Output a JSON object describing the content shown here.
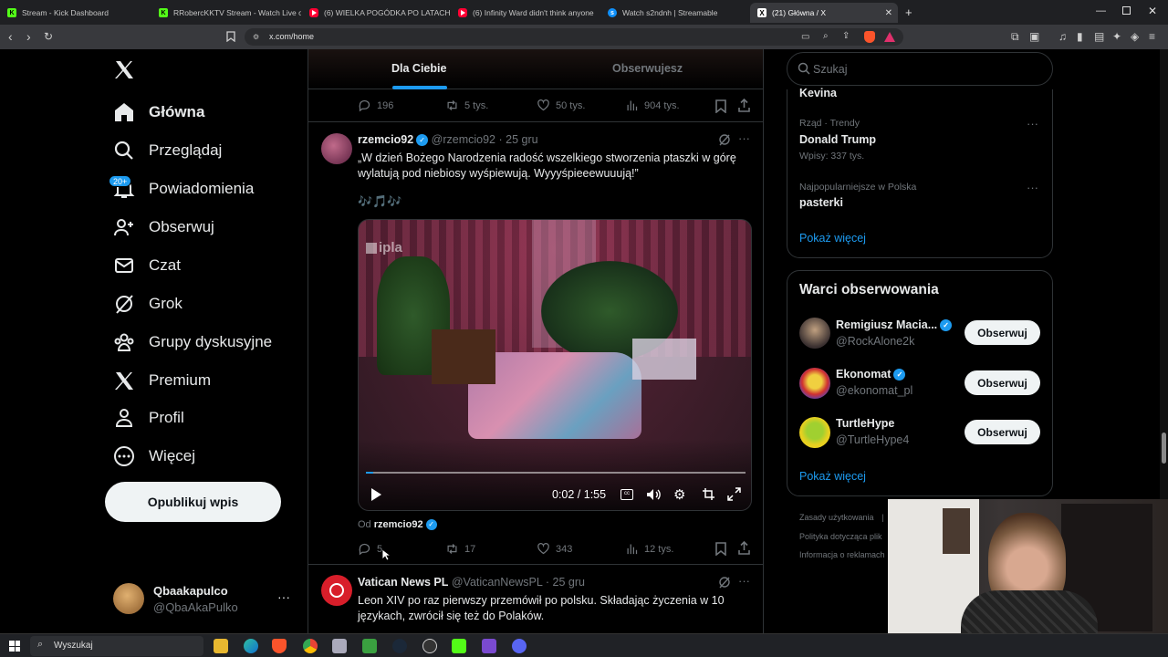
{
  "browser": {
    "tabs": [
      {
        "title": "Stream - Kick Dashboard",
        "icon": "kick-icon",
        "color": "#53fc18"
      },
      {
        "title": "RRobercKKTV Stream - Watch Live o",
        "icon": "kick-icon",
        "color": "#53fc18"
      },
      {
        "title": "(6) WIELKA POGÓDKA PO LATACH (",
        "icon": "youtube-icon",
        "color": "#ff0033"
      },
      {
        "title": "(6) Infinity Ward didn't think anyone",
        "icon": "youtube-icon",
        "color": "#ff0033"
      },
      {
        "title": "Watch s2ndnh | Streamable",
        "icon": "streamable-icon",
        "color": "#0f90fa"
      },
      {
        "title": "(21) Główna / X",
        "icon": "x-icon",
        "color": "#ffffff"
      }
    ],
    "new_tab": "+",
    "url": "x.com/home"
  },
  "nav": {
    "items": [
      {
        "label": "Główna",
        "icon": "home-icon",
        "bold": true
      },
      {
        "label": "Przeglądaj",
        "icon": "search-icon"
      },
      {
        "label": "Powiadomienia",
        "icon": "bell-icon",
        "badge": "20+"
      },
      {
        "label": "Obserwuj",
        "icon": "follow-icon"
      },
      {
        "label": "Czat",
        "icon": "mail-icon"
      },
      {
        "label": "Grok",
        "icon": "grok-icon"
      },
      {
        "label": "Grupy dyskusyjne",
        "icon": "communities-icon"
      },
      {
        "label": "Premium",
        "icon": "x-icon"
      },
      {
        "label": "Profil",
        "icon": "profile-icon"
      },
      {
        "label": "Więcej",
        "icon": "more-icon"
      }
    ],
    "post_button": "Opublikuj wpis",
    "account": {
      "name": "Qbaakapulco",
      "handle": "@QbaAkaPulko",
      "more": "···"
    }
  },
  "feed": {
    "tabs": [
      "Dla Ciebie",
      "Obserwujesz"
    ],
    "prev_actions": {
      "replies": "196",
      "reposts": "5 tys.",
      "likes": "50 tys.",
      "views": "904 tys."
    },
    "tweet1": {
      "name": "rzemcio92",
      "handle": "@rzemcio92",
      "date": "· 25 gru",
      "text": "„W dzień Bożego Narodzenia radość wszelkiego stworzenia ptaszki w górę wylatują pod niebiosy wyśpiewują. Wyyyśpieeewuuują!”",
      "emoji": "🎶🎵🎶",
      "video_watermark": "ipla",
      "video_time": "0:02 / 1:55",
      "video_progress": 0.02,
      "from_label": "Od",
      "from_name": "rzemcio92",
      "actions": {
        "replies": "5",
        "reposts": "17",
        "likes": "343",
        "views": "12 tys."
      }
    },
    "tweet2": {
      "name": "Vatican News PL",
      "handle": "@VaticanNewsPL",
      "date": "· 25 gru",
      "text": "Leon XIV po raz pierwszy przemówił po polsku. Składając życzenia w 10 językach, zwrócił się też do Polaków."
    }
  },
  "right": {
    "search_placeholder": "Szukaj",
    "trends": {
      "top_cut": "Kevina",
      "items": [
        {
          "meta": "Rząd · Trendy",
          "title": "Donald Trump",
          "count": "Wpisy: 337 tys."
        },
        {
          "meta": "Najpopularniejsze w Polska",
          "title": "pasterki",
          "count": ""
        }
      ],
      "show_more": "Pokaż więcej"
    },
    "who_to_follow": {
      "title": "Warci obserwowania",
      "users": [
        {
          "name": "Remigiusz Macia...",
          "handle": "@RockAlone2k"
        },
        {
          "name": "Ekonomat",
          "handle": "@ekonomat_pl"
        },
        {
          "name": "TurtleHype",
          "handle": "@TurtleHype4"
        }
      ],
      "follow_label": "Obserwuj",
      "show_more": "Pokaż więcej"
    },
    "footer": [
      "Zasady użytkowania",
      "|",
      "Polityka dotycząca plik",
      "Informacja o reklamach"
    ]
  },
  "taskbar": {
    "search_placeholder": "Wyszukaj"
  }
}
